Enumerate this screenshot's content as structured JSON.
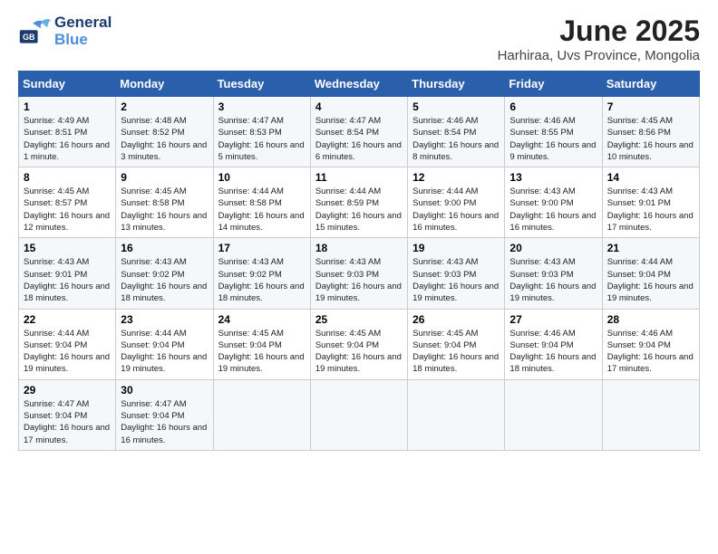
{
  "header": {
    "logo": {
      "line1": "General",
      "line2": "Blue"
    },
    "title": "June 2025",
    "subtitle": "Harhiraa, Uvs Province, Mongolia"
  },
  "days_of_week": [
    "Sunday",
    "Monday",
    "Tuesday",
    "Wednesday",
    "Thursday",
    "Friday",
    "Saturday"
  ],
  "weeks": [
    [
      {
        "day": "1",
        "sunrise": "Sunrise: 4:49 AM",
        "sunset": "Sunset: 8:51 PM",
        "daylight": "Daylight: 16 hours and 1 minute."
      },
      {
        "day": "2",
        "sunrise": "Sunrise: 4:48 AM",
        "sunset": "Sunset: 8:52 PM",
        "daylight": "Daylight: 16 hours and 3 minutes."
      },
      {
        "day": "3",
        "sunrise": "Sunrise: 4:47 AM",
        "sunset": "Sunset: 8:53 PM",
        "daylight": "Daylight: 16 hours and 5 minutes."
      },
      {
        "day": "4",
        "sunrise": "Sunrise: 4:47 AM",
        "sunset": "Sunset: 8:54 PM",
        "daylight": "Daylight: 16 hours and 6 minutes."
      },
      {
        "day": "5",
        "sunrise": "Sunrise: 4:46 AM",
        "sunset": "Sunset: 8:54 PM",
        "daylight": "Daylight: 16 hours and 8 minutes."
      },
      {
        "day": "6",
        "sunrise": "Sunrise: 4:46 AM",
        "sunset": "Sunset: 8:55 PM",
        "daylight": "Daylight: 16 hours and 9 minutes."
      },
      {
        "day": "7",
        "sunrise": "Sunrise: 4:45 AM",
        "sunset": "Sunset: 8:56 PM",
        "daylight": "Daylight: 16 hours and 10 minutes."
      }
    ],
    [
      {
        "day": "8",
        "sunrise": "Sunrise: 4:45 AM",
        "sunset": "Sunset: 8:57 PM",
        "daylight": "Daylight: 16 hours and 12 minutes."
      },
      {
        "day": "9",
        "sunrise": "Sunrise: 4:45 AM",
        "sunset": "Sunset: 8:58 PM",
        "daylight": "Daylight: 16 hours and 13 minutes."
      },
      {
        "day": "10",
        "sunrise": "Sunrise: 4:44 AM",
        "sunset": "Sunset: 8:58 PM",
        "daylight": "Daylight: 16 hours and 14 minutes."
      },
      {
        "day": "11",
        "sunrise": "Sunrise: 4:44 AM",
        "sunset": "Sunset: 8:59 PM",
        "daylight": "Daylight: 16 hours and 15 minutes."
      },
      {
        "day": "12",
        "sunrise": "Sunrise: 4:44 AM",
        "sunset": "Sunset: 9:00 PM",
        "daylight": "Daylight: 16 hours and 16 minutes."
      },
      {
        "day": "13",
        "sunrise": "Sunrise: 4:43 AM",
        "sunset": "Sunset: 9:00 PM",
        "daylight": "Daylight: 16 hours and 16 minutes."
      },
      {
        "day": "14",
        "sunrise": "Sunrise: 4:43 AM",
        "sunset": "Sunset: 9:01 PM",
        "daylight": "Daylight: 16 hours and 17 minutes."
      }
    ],
    [
      {
        "day": "15",
        "sunrise": "Sunrise: 4:43 AM",
        "sunset": "Sunset: 9:01 PM",
        "daylight": "Daylight: 16 hours and 18 minutes."
      },
      {
        "day": "16",
        "sunrise": "Sunrise: 4:43 AM",
        "sunset": "Sunset: 9:02 PM",
        "daylight": "Daylight: 16 hours and 18 minutes."
      },
      {
        "day": "17",
        "sunrise": "Sunrise: 4:43 AM",
        "sunset": "Sunset: 9:02 PM",
        "daylight": "Daylight: 16 hours and 18 minutes."
      },
      {
        "day": "18",
        "sunrise": "Sunrise: 4:43 AM",
        "sunset": "Sunset: 9:03 PM",
        "daylight": "Daylight: 16 hours and 19 minutes."
      },
      {
        "day": "19",
        "sunrise": "Sunrise: 4:43 AM",
        "sunset": "Sunset: 9:03 PM",
        "daylight": "Daylight: 16 hours and 19 minutes."
      },
      {
        "day": "20",
        "sunrise": "Sunrise: 4:43 AM",
        "sunset": "Sunset: 9:03 PM",
        "daylight": "Daylight: 16 hours and 19 minutes."
      },
      {
        "day": "21",
        "sunrise": "Sunrise: 4:44 AM",
        "sunset": "Sunset: 9:04 PM",
        "daylight": "Daylight: 16 hours and 19 minutes."
      }
    ],
    [
      {
        "day": "22",
        "sunrise": "Sunrise: 4:44 AM",
        "sunset": "Sunset: 9:04 PM",
        "daylight": "Daylight: 16 hours and 19 minutes."
      },
      {
        "day": "23",
        "sunrise": "Sunrise: 4:44 AM",
        "sunset": "Sunset: 9:04 PM",
        "daylight": "Daylight: 16 hours and 19 minutes."
      },
      {
        "day": "24",
        "sunrise": "Sunrise: 4:45 AM",
        "sunset": "Sunset: 9:04 PM",
        "daylight": "Daylight: 16 hours and 19 minutes."
      },
      {
        "day": "25",
        "sunrise": "Sunrise: 4:45 AM",
        "sunset": "Sunset: 9:04 PM",
        "daylight": "Daylight: 16 hours and 19 minutes."
      },
      {
        "day": "26",
        "sunrise": "Sunrise: 4:45 AM",
        "sunset": "Sunset: 9:04 PM",
        "daylight": "Daylight: 16 hours and 18 minutes."
      },
      {
        "day": "27",
        "sunrise": "Sunrise: 4:46 AM",
        "sunset": "Sunset: 9:04 PM",
        "daylight": "Daylight: 16 hours and 18 minutes."
      },
      {
        "day": "28",
        "sunrise": "Sunrise: 4:46 AM",
        "sunset": "Sunset: 9:04 PM",
        "daylight": "Daylight: 16 hours and 17 minutes."
      }
    ],
    [
      {
        "day": "29",
        "sunrise": "Sunrise: 4:47 AM",
        "sunset": "Sunset: 9:04 PM",
        "daylight": "Daylight: 16 hours and 17 minutes."
      },
      {
        "day": "30",
        "sunrise": "Sunrise: 4:47 AM",
        "sunset": "Sunset: 9:04 PM",
        "daylight": "Daylight: 16 hours and 16 minutes."
      },
      null,
      null,
      null,
      null,
      null
    ]
  ]
}
